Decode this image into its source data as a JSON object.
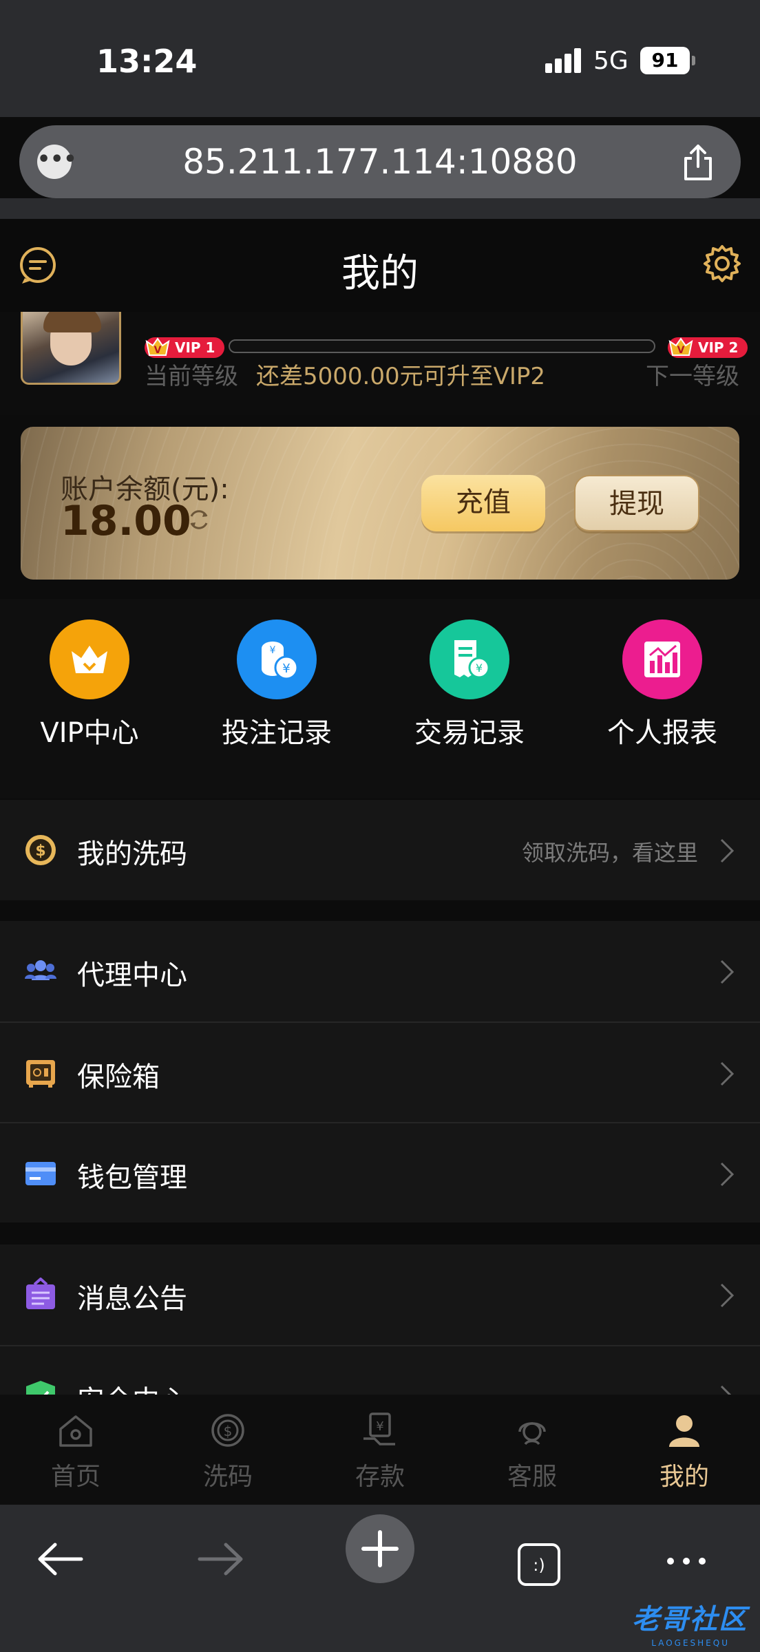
{
  "status_bar": {
    "time": "13:24",
    "network": "5G",
    "battery": "91"
  },
  "browser": {
    "url": "85.211.177.114:10880"
  },
  "header": {
    "title": "我的"
  },
  "profile": {
    "current_vip": "VIP 1",
    "next_vip": "VIP 2",
    "current_level_label": "当前等级",
    "next_level_label": "下一等级",
    "upgrade_hint": "还差5000.00元可升至VIP2",
    "progress": 0.0
  },
  "balance": {
    "label": "账户余额(元):",
    "value": "18.00",
    "recharge_label": "充值",
    "withdraw_label": "提现"
  },
  "quick_menu": [
    {
      "label": "VIP中心",
      "icon": "crown-icon",
      "color": "#f5a30a"
    },
    {
      "label": "投注记录",
      "icon": "coins-icon",
      "color": "#1d8ff2"
    },
    {
      "label": "交易记录",
      "icon": "receipt-icon",
      "color": "#16c79a"
    },
    {
      "label": "个人报表",
      "icon": "chart-icon",
      "color": "#ec1d8f"
    }
  ],
  "list_sections": {
    "rebate": {
      "label": "我的洗码",
      "hint": "领取洗码，看这里"
    },
    "agent": {
      "label": "代理中心"
    },
    "safe": {
      "label": "保险箱"
    },
    "wallet": {
      "label": "钱包管理"
    },
    "notice": {
      "label": "消息公告"
    },
    "security": {
      "label": "安全中心"
    }
  },
  "tabbar": [
    {
      "label": "首页",
      "icon": "home-icon"
    },
    {
      "label": "洗码",
      "icon": "rebate-icon"
    },
    {
      "label": "存款",
      "icon": "deposit-icon"
    },
    {
      "label": "客服",
      "icon": "support-icon"
    },
    {
      "label": "我的",
      "icon": "profile-icon",
      "active": true
    }
  ],
  "colors": {
    "gold": "#e9c894",
    "background": "#0c0c0c",
    "vip_red": "#e51c3c"
  },
  "watermark": {
    "text": "老哥社区",
    "sub": "LAOGESHEQU"
  }
}
